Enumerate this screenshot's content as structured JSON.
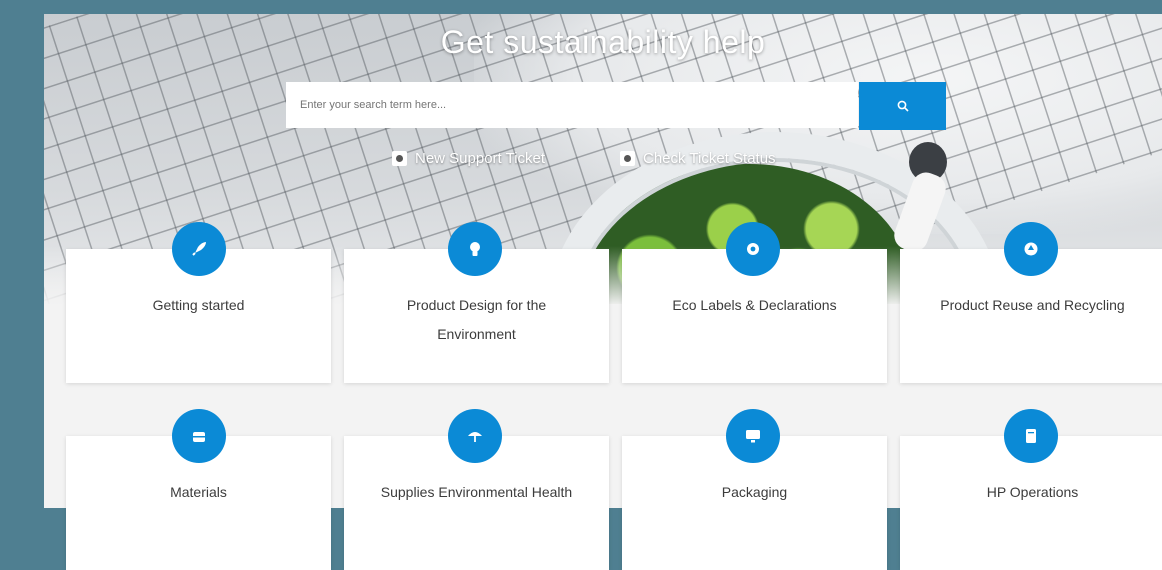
{
  "hero": {
    "title": "Get sustainability help",
    "search_placeholder": "Enter your search term here...",
    "new_ticket_label": "New Support Ticket",
    "check_status_label": "Check Ticket Status"
  },
  "colors": {
    "accent": "#0b8ad6",
    "frame": "#4f7f91"
  },
  "categories": [
    {
      "label": "Getting started",
      "icon": "rocket-icon"
    },
    {
      "label": "Product Design for the Environment",
      "icon": "lightbulb-icon"
    },
    {
      "label": "Eco Labels & Declarations",
      "icon": "gear-icon"
    },
    {
      "label": "Product Reuse and Recycling",
      "icon": "recycle-icon"
    },
    {
      "label": "Materials",
      "icon": "toolbox-icon"
    },
    {
      "label": "Supplies Environmental Health",
      "icon": "umbrella-icon"
    },
    {
      "label": "Packaging",
      "icon": "monitor-icon"
    },
    {
      "label": "HP Operations",
      "icon": "document-icon"
    }
  ]
}
